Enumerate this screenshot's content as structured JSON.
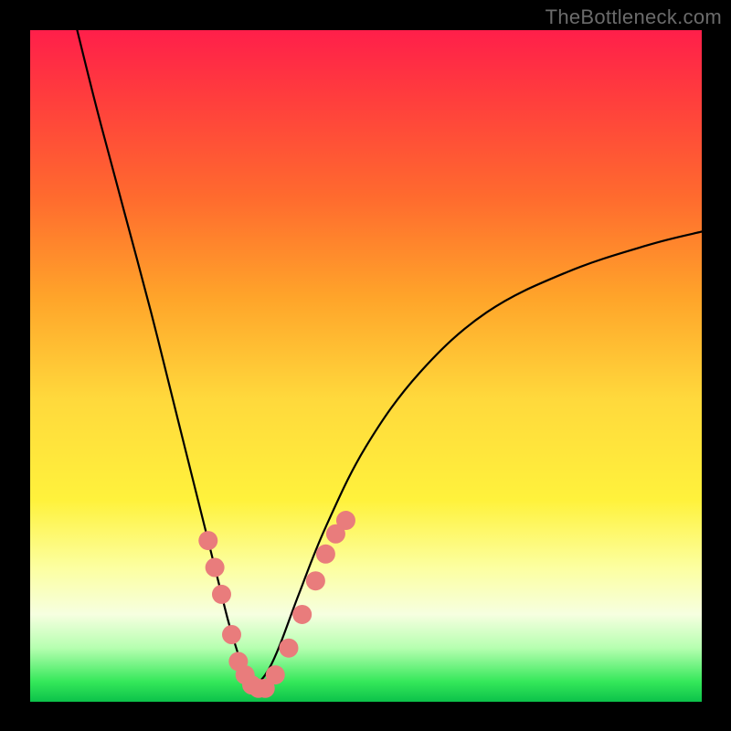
{
  "watermark": "TheBottleneck.com",
  "chart_data": {
    "type": "line",
    "title": "",
    "xlabel": "",
    "ylabel": "",
    "xlim": [
      0,
      100
    ],
    "ylim": [
      0,
      100
    ],
    "series": [
      {
        "name": "left-branch",
        "x": [
          7,
          10,
          14,
          18,
          22,
          24,
          26,
          28,
          29.5,
          31,
          32,
          33
        ],
        "values": [
          100,
          88,
          73,
          58,
          42,
          34,
          26,
          18,
          12,
          7,
          4,
          2
        ]
      },
      {
        "name": "right-branch",
        "x": [
          33,
          35,
          37,
          40,
          44,
          50,
          58,
          68,
          80,
          92,
          100
        ],
        "values": [
          2,
          4,
          8,
          16,
          26,
          38,
          49,
          58,
          64,
          68,
          70
        ]
      }
    ],
    "dots": {
      "name": "highlighted-points",
      "x_left": [
        26.5,
        27.5,
        28.5,
        30.0,
        31.0,
        32.0,
        33.0,
        34.0
      ],
      "y_left": [
        24,
        20,
        16,
        10,
        6,
        4,
        2.5,
        2
      ],
      "x_right": [
        35.0,
        36.5,
        38.5,
        40.5,
        42.5,
        44.0,
        45.5,
        47.0
      ],
      "y_right": [
        2,
        4,
        8,
        13,
        18,
        22,
        25,
        27
      ]
    },
    "optimum_x": 33
  }
}
